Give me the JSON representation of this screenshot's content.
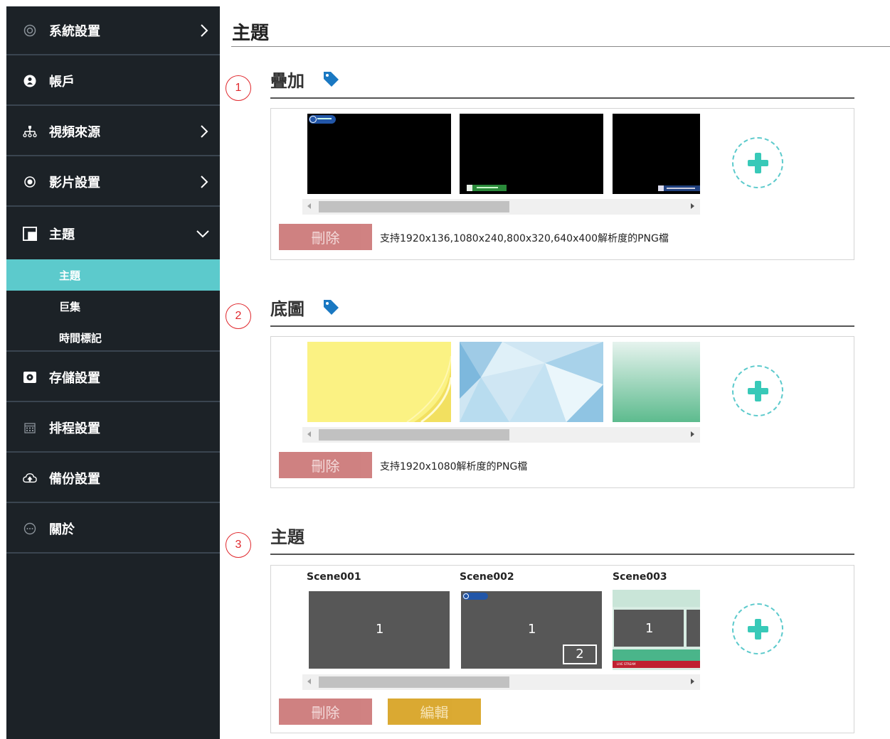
{
  "sidebar": {
    "items": [
      {
        "label": "系統設置",
        "icon": "settings-ring-icon",
        "arrow": "chevron-right"
      },
      {
        "label": "帳戶",
        "icon": "user-icon",
        "arrow": ""
      },
      {
        "label": "視頻來源",
        "icon": "network-icon",
        "arrow": "chevron-right"
      },
      {
        "label": "影片設置",
        "icon": "radio-dot-icon",
        "arrow": "chevron-right"
      },
      {
        "label": "主題",
        "icon": "theme-icon",
        "arrow": "chevron-down"
      },
      {
        "label": "存儲設置",
        "icon": "storage-icon",
        "arrow": ""
      },
      {
        "label": "排程設置",
        "icon": "calendar-icon",
        "arrow": ""
      },
      {
        "label": "備份設置",
        "icon": "cloud-upload-icon",
        "arrow": ""
      },
      {
        "label": "關於",
        "icon": "chat-bubble-icon",
        "arrow": ""
      }
    ],
    "subitems": [
      "主題",
      "巨集",
      "時間標記"
    ]
  },
  "page": {
    "title": "主題"
  },
  "markers": [
    "1",
    "2",
    "3"
  ],
  "overlay": {
    "title": "疊加",
    "delete_label": "刪除",
    "hint": "支持1920x136,1080x240,800x320,640x400解析度的PNG檔"
  },
  "background": {
    "title": "底圖",
    "delete_label": "刪除",
    "hint": "支持1920x1080解析度的PNG檔"
  },
  "theme": {
    "title": "主題",
    "delete_label": "刪除",
    "edit_label": "編輯",
    "scenes": [
      {
        "name": "Scene001",
        "box1": "1"
      },
      {
        "name": "Scene002",
        "box1": "1",
        "box2": "2"
      },
      {
        "name": "Scene003",
        "box1": "1",
        "ticker": "LIVE STREAM"
      }
    ]
  },
  "colors": {
    "sidebar_bg": "#1c2227",
    "accent": "#5ccacc",
    "delete": "#cd7b7b",
    "edit": "#d9a528",
    "marker": "#e0282d",
    "tag": "#1a78c2"
  }
}
